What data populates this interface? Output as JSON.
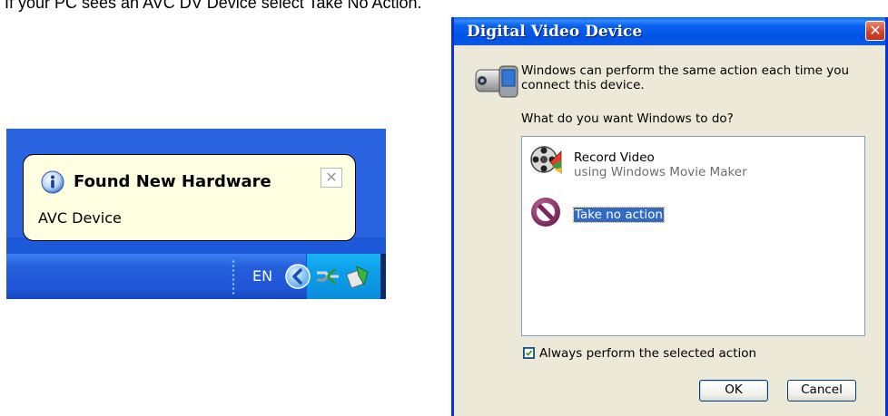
{
  "caption": "If your PC sees an AVC DV Device select Take No Action.",
  "balloon": {
    "title": "Found New Hardware",
    "body": "AVC Device",
    "close_glyph": "✕"
  },
  "taskbar": {
    "language": "EN",
    "icons": [
      "show-hidden-icons-chevron",
      "network-cable-icon",
      "safely-remove-hardware-icon"
    ]
  },
  "dialog": {
    "title": "Digital Video Device",
    "close_glyph": "✕",
    "intro": "Windows can perform the same action each time you connect this device.",
    "question": "What do you want Windows to do?",
    "actions": [
      {
        "title": "Record Video",
        "subtitle": "using Windows Movie Maker",
        "icon": "movie-maker-icon",
        "selected": false
      },
      {
        "title": "Take no action",
        "subtitle": "",
        "icon": "no-action-icon",
        "selected": true
      }
    ],
    "always_label": "Always perform the selected action",
    "always_checked": true,
    "ok_label": "OK",
    "cancel_label": "Cancel"
  },
  "colors": {
    "titlebar": "#0054e3",
    "dialog_bg": "#ece9d8",
    "selection": "#316ac5",
    "balloon_bg": "#ffffe1",
    "taskbar": "#245edb"
  }
}
